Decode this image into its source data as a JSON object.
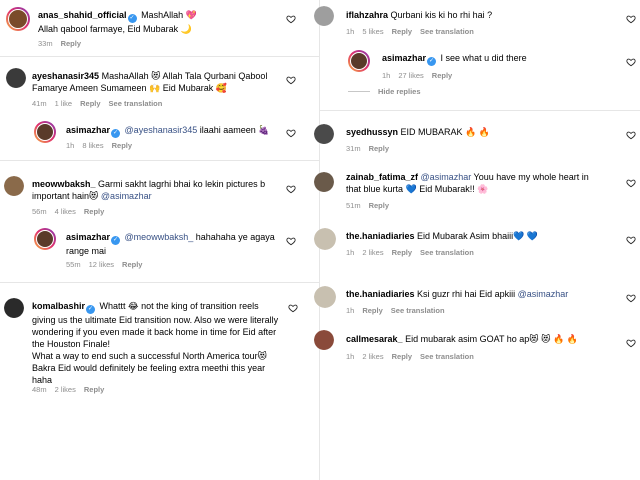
{
  "left": [
    {
      "user": "anas_shahid_official",
      "verified": true,
      "text": "MashAllah 💖",
      "text2": "Allah qabool farmaye, Eid Mubarak 🌙",
      "time": "33m",
      "likes": "",
      "reply": "Reply",
      "translation": "",
      "avatar_color": "#7a4b2a"
    },
    {
      "user": "ayeshanasir345",
      "verified": false,
      "text": "MashaAllah 😻 Allah Tala Qurbani Qabool",
      "text2": "Famarye Ameen Sumameen 🙌 Eid Mubarak 🥰",
      "time": "41m",
      "likes": "1 like",
      "reply": "Reply",
      "translation": "See translation",
      "avatar_color": "#3a3a3a"
    },
    {
      "user": "asimazhar",
      "verified": true,
      "mention": "@ayeshanasir345",
      "text": " ilaahi aameen 🍇",
      "time": "1h",
      "likes": "8 likes",
      "reply": "Reply",
      "avatar_color": "#5a3a2a"
    },
    {
      "user": "meowwbaksh_",
      "verified": false,
      "text": "Garmi sakht lagrhi bhai ko lekin pictures b",
      "text2": "important hain😻 ",
      "mention": "@asimazhar",
      "time": "56m",
      "likes": "4 likes",
      "reply": "Reply",
      "avatar_color": "#8a6a4a"
    },
    {
      "user": "asimazhar",
      "verified": true,
      "mention": "@meowwbaksh_",
      "text": " hahahaha ye agaya",
      "text2": "range mai",
      "time": "55m",
      "likes": "12 likes",
      "reply": "Reply",
      "avatar_color": "#5a3a2a"
    },
    {
      "user": "komalbashir",
      "verified": true,
      "lines": [
        "Whattt 😂 not the king of transition reels",
        "giving us the ultimate Eid transition now. Also we were literally",
        "wondering if you even made it back home in time for Eid after",
        "the Houston Finale!",
        "What a way to end such a successful North America tour😻",
        "Bakra Eid would definitely be feeling extra meethi this year",
        "haha"
      ],
      "time": "48m",
      "likes": "2 likes",
      "reply": "Reply",
      "avatar_color": "#2a2a2a"
    }
  ],
  "right": [
    {
      "user": "iflahzahra",
      "text": "Qurbani kis ki ho rhi hai ?",
      "time": "1h",
      "likes": "5 likes",
      "reply": "Reply",
      "translation": "See translation",
      "avatar_color": "#9e9e9e"
    },
    {
      "user": "asimazhar",
      "verified": true,
      "text": "I see what u did there",
      "time": "1h",
      "likes": "27 likes",
      "reply": "Reply",
      "avatar_color": "#5a3a2a"
    },
    {
      "hide": "Hide replies"
    },
    {
      "user": "syedhussyn",
      "text": "EID MUBARAK 🔥 🔥",
      "time": "31m",
      "likes": "",
      "reply": "Reply",
      "avatar_color": "#4a4a4a"
    },
    {
      "user": "zainab_fatima_zf",
      "mention": "@asimazhar",
      "text": " Youu have my whole heart in",
      "text2": "that blue kurta 💙 Eid Mubarak!! 🌸",
      "time": "51m",
      "likes": "",
      "reply": "Reply",
      "avatar_color": "#6a5a4a"
    },
    {
      "user": "the.haniadiaries",
      "text": "Eid Mubarak Asim bhaiii💙 💙",
      "time": "1h",
      "likes": "2 likes",
      "reply": "Reply",
      "translation": "See translation",
      "avatar_color": "#c8c0b0"
    },
    {
      "user": "the.haniadiaries",
      "text": "Ksi guzr rhi hai Eid apkiii ",
      "mention": "@asimazhar",
      "time": "1h",
      "likes": "",
      "reply": "Reply",
      "translation": "See translation",
      "avatar_color": "#c8c0b0"
    },
    {
      "user": "callmesarak_",
      "text": "Eid mubarak asim GOAT ho ap😻 😻 🔥 🔥",
      "time": "1h",
      "likes": "2 likes",
      "reply": "Reply",
      "translation": "See translation",
      "avatar_color": "#8a4a3a"
    }
  ],
  "colors": {
    "link": "#385185",
    "meta": "#8e8e8e",
    "verified": "#3897f0"
  }
}
